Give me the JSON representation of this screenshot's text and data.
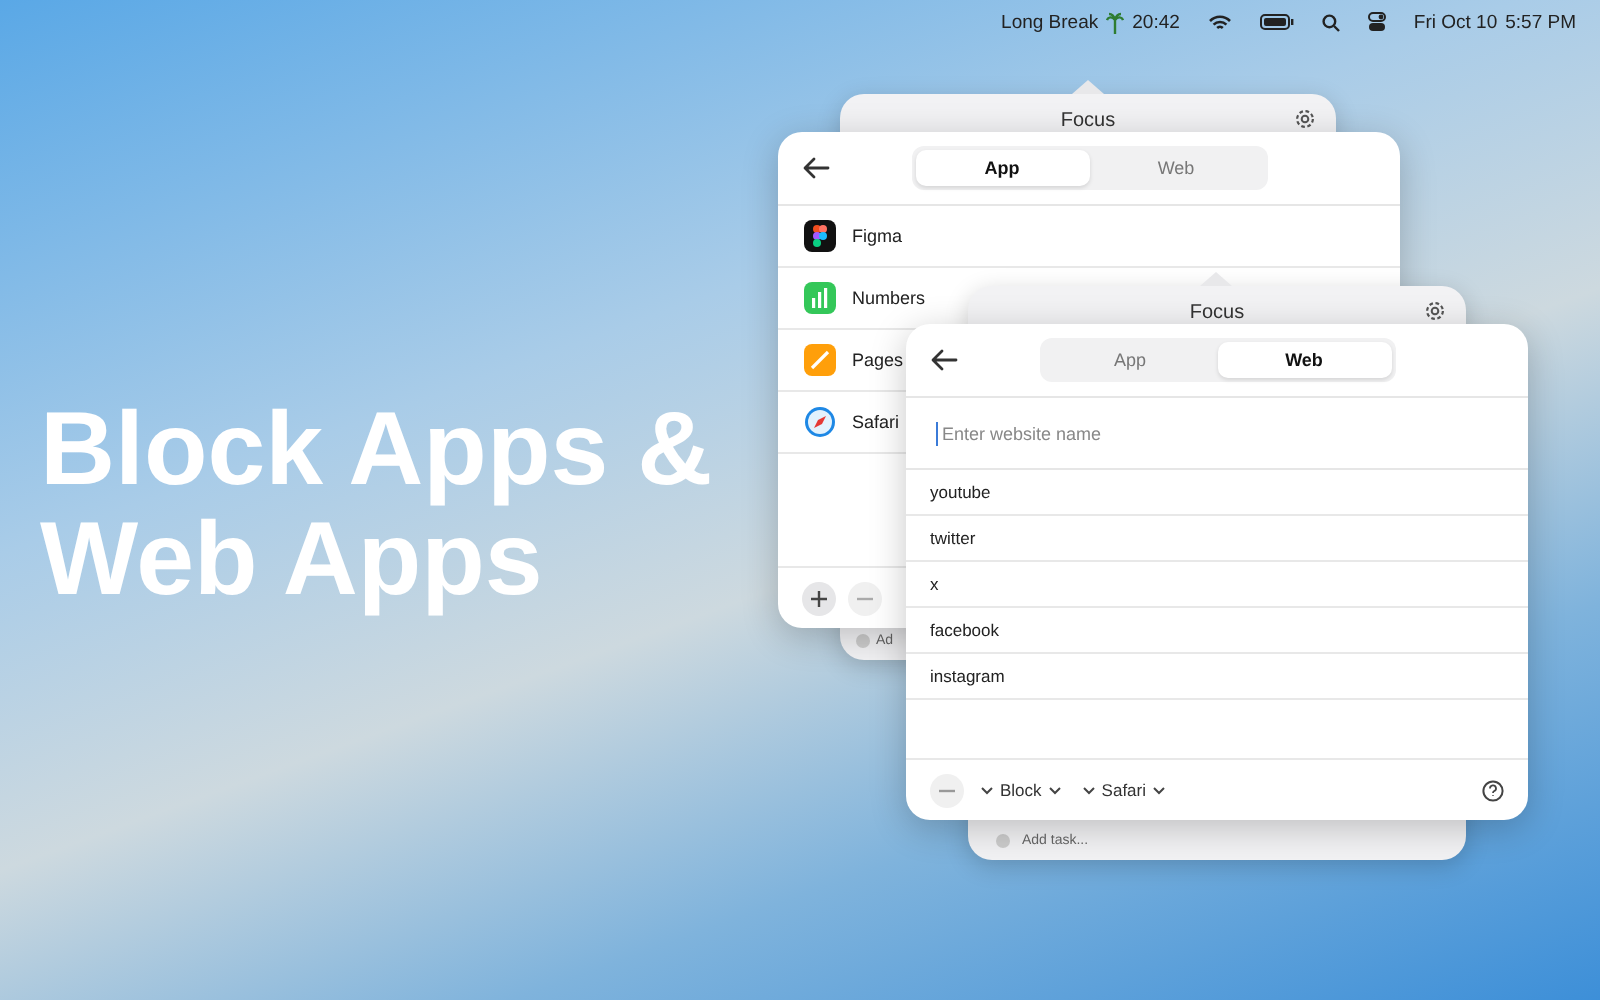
{
  "menubar": {
    "timer_label": "Long Break",
    "timer": "20:42",
    "date": "Fri Oct 10",
    "time": "5:57 PM"
  },
  "headline": "Block Apps & Web Apps",
  "focus_windows": [
    {
      "title": "Focus",
      "add_task": "Ad"
    },
    {
      "title": "Focus",
      "add_task": "Add task..."
    }
  ],
  "app_panel": {
    "tabs": [
      {
        "label": "App",
        "selected": true
      },
      {
        "label": "Web",
        "selected": false
      }
    ],
    "apps": [
      {
        "name": "Figma",
        "kind": "figma"
      },
      {
        "name": "Numbers",
        "kind": "numbers"
      },
      {
        "name": "Pages",
        "kind": "pages"
      },
      {
        "name": "Safari",
        "kind": "safari"
      }
    ]
  },
  "web_panel": {
    "tabs": [
      {
        "label": "App",
        "selected": false
      },
      {
        "label": "Web",
        "selected": true
      }
    ],
    "input": {
      "placeholder": "Enter website name"
    },
    "sites": [
      "youtube",
      "twitter",
      "x",
      "facebook",
      "instagram"
    ],
    "action": "Block",
    "browser": "Safari"
  }
}
